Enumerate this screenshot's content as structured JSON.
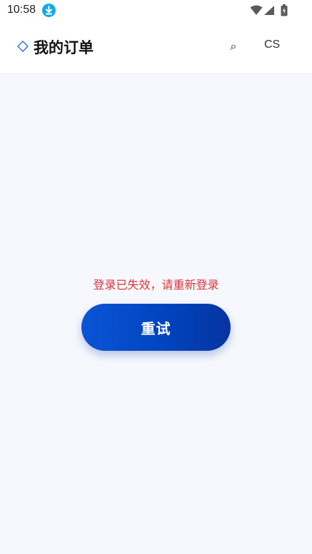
{
  "status_bar": {
    "time": "10:58",
    "icons": [
      "download-icon",
      "wifi-icon",
      "signal-icon",
      "battery-icon"
    ]
  },
  "header": {
    "icon": "diamond-icon",
    "title": "我的订单",
    "search_glyph": "⌕",
    "cs_label": "CS"
  },
  "main": {
    "error_message": "登录已失效，请重新登录",
    "retry_label": "重试"
  },
  "colors": {
    "accent": "#0044bf",
    "error": "#d9363e",
    "background": "#f7f8fd"
  }
}
